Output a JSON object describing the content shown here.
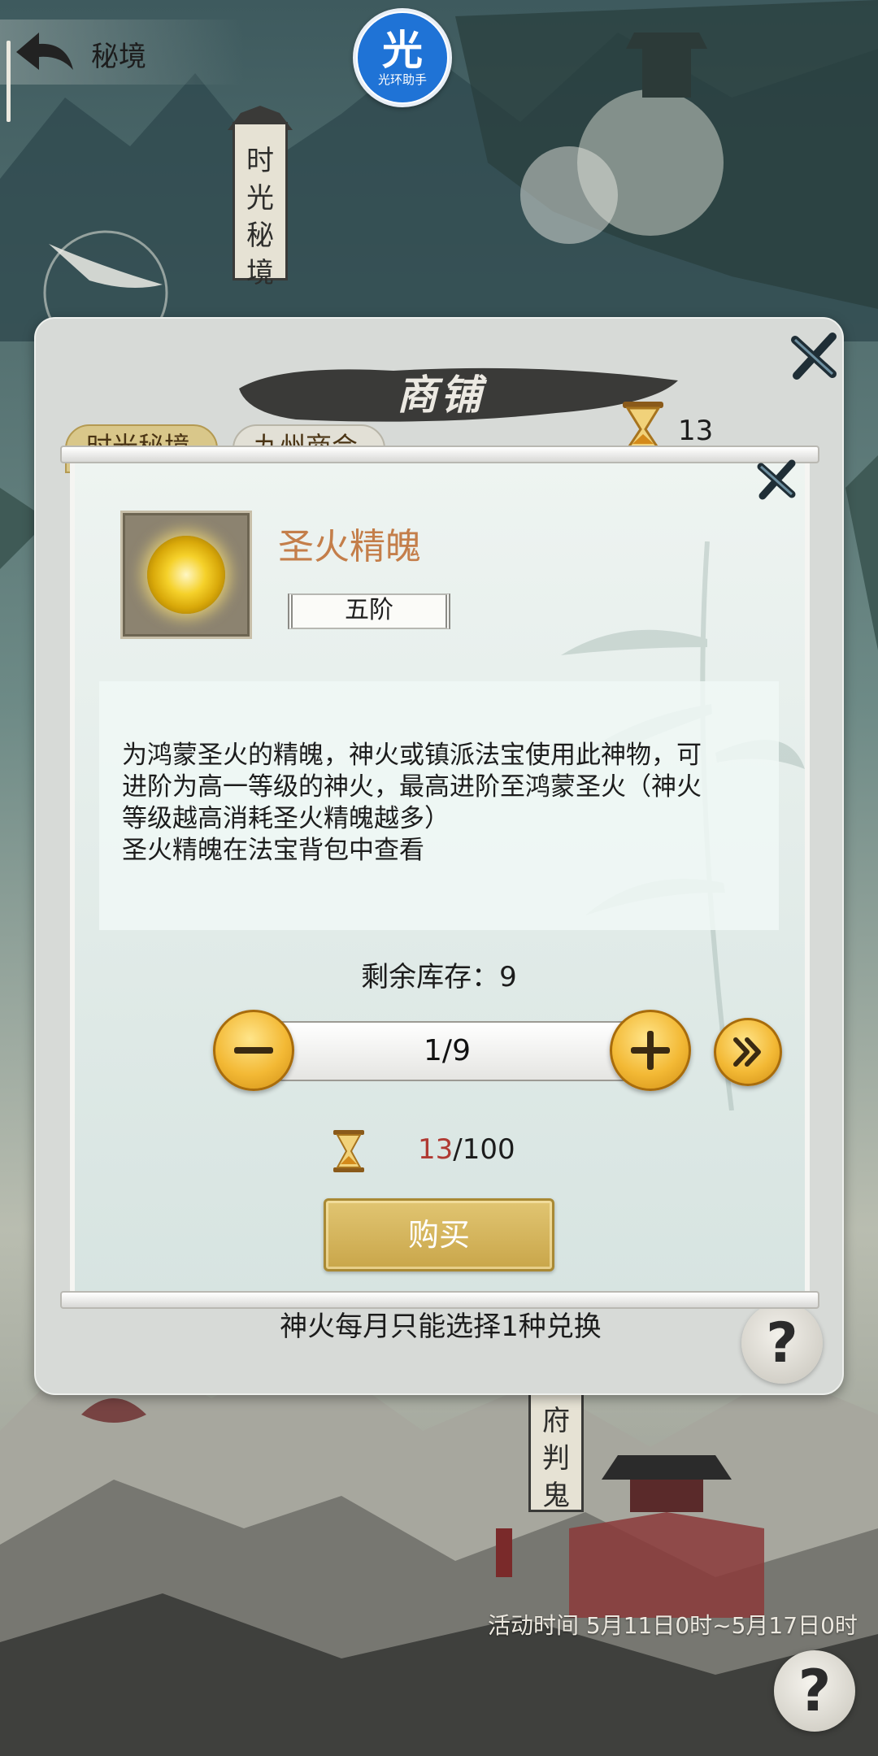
{
  "top_bar": {
    "title": "秘境"
  },
  "badge": {
    "main": "光",
    "sub": "光环助手"
  },
  "banner_top": {
    "chars": [
      "时",
      "光",
      "秘",
      "境"
    ]
  },
  "banner_bottom": {
    "chars": [
      "府",
      "判",
      "鬼"
    ]
  },
  "event": {
    "time_text": "活动时间 5月11日0时~5月17日0时"
  },
  "shop": {
    "title": "商铺",
    "currency_count": "13",
    "tabs": [
      "时光秘境",
      "九州商会"
    ],
    "footer_note": "神火每月只能选择1种兑换"
  },
  "dialog": {
    "item_name": "圣火精魄",
    "tier": "五阶",
    "description_lines": [
      "为鸿蒙圣火的精魄，神火或镇派法宝使用此神物，可",
      "进阶为高一等级的神火，最高进阶至鸿蒙圣火（神火",
      "等级越高消耗圣火精魄越多）",
      "圣火精魄在法宝背包中查看"
    ],
    "stock_label": "剩余库存：9",
    "quantity": "1/9",
    "cost_have": "13",
    "cost_need": "/100",
    "buy_label": "购买"
  },
  "colors": {
    "item_name": "#c47e4a",
    "cost_have": "#b03a33",
    "gold_button": "#f3b935",
    "badge_blue": "#1f73d6"
  },
  "icons": {
    "back": "back-arrow-icon",
    "close": "close-x-icon",
    "currency": "hourglass-icon",
    "minus": "minus-icon",
    "plus": "plus-icon",
    "max": "double-chevron-right-icon",
    "help": "question-mark-icon"
  }
}
